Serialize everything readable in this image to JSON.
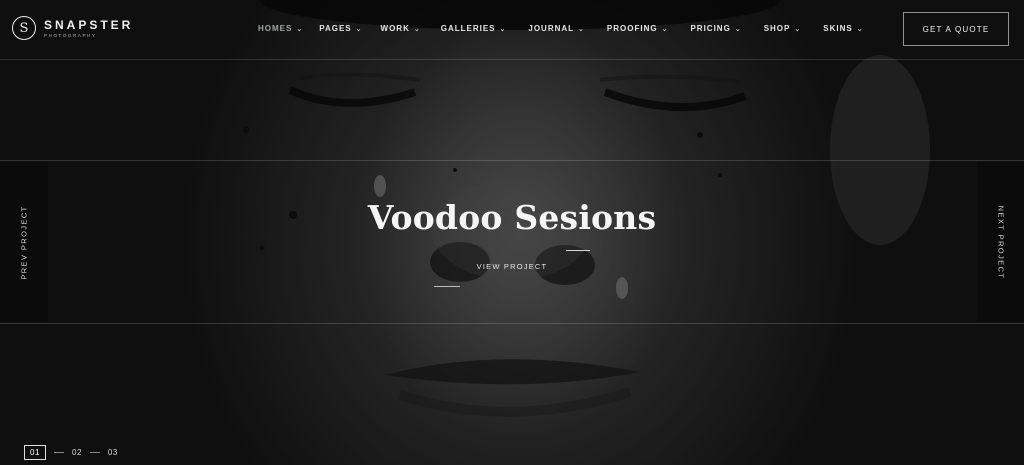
{
  "brand": {
    "name": "SNAPSTER",
    "subtitle": "PHOTOGRAPHY",
    "mark": "S"
  },
  "nav": [
    {
      "label": "HOMES",
      "active": true
    },
    {
      "label": "PAGES"
    },
    {
      "label": "WORK"
    },
    {
      "label": "GALLERIES"
    },
    {
      "label": "JOURNAL"
    },
    {
      "label": "PROOFING"
    },
    {
      "label": "PRICING"
    },
    {
      "label": "SHOP"
    },
    {
      "label": "SKINS"
    }
  ],
  "cta": {
    "label": "GET A QUOTE"
  },
  "slide": {
    "title": "Voodoo Sesions",
    "link": "VIEW PROJECT"
  },
  "side": {
    "prev": "PREV PROJECT",
    "next": "NEXT PROJECT"
  },
  "pager": {
    "pages": [
      "01",
      "02",
      "03"
    ],
    "active": "01"
  },
  "colors": {
    "accent_active_nav": "#9fa6a6",
    "background": "#111111"
  }
}
